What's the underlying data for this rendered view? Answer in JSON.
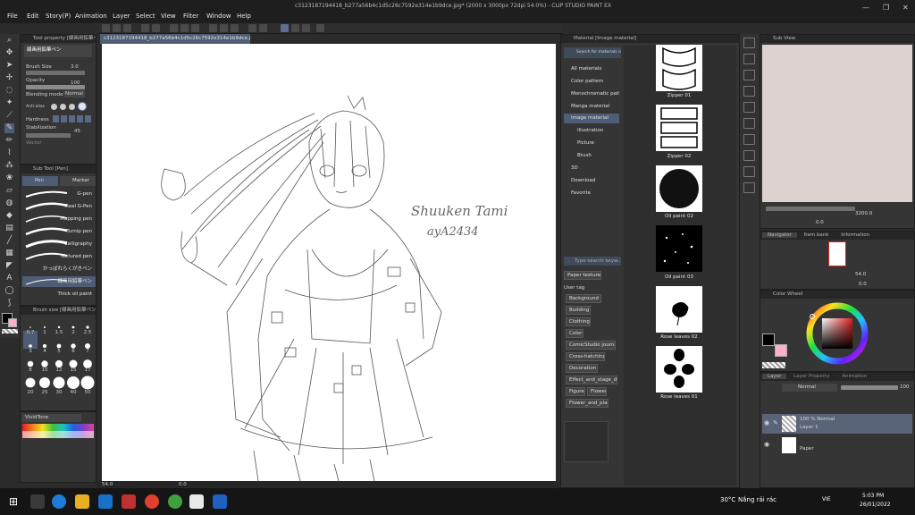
{
  "window": {
    "title": "c3123187194418_b277a56b4c1d5c26c7592e314e1b9dce.jpg* (2000 x 3000px 72dpi 54.0%) - CLIP STUDIO PAINT EX",
    "min_label": "—",
    "max_label": "❐",
    "close_label": "✕"
  },
  "menu": [
    "File",
    "Edit",
    "Story(P)",
    "Animation",
    "Layer",
    "Select",
    "View",
    "Filter",
    "Window",
    "Help"
  ],
  "document_tab": "c3123187194418_b277a56b4c1d5c26c7592e314e1b9dce.jpg*",
  "tool_property": {
    "header": "Tool property [線画用鉛筆ペン]",
    "brush_name": "線画用鉛筆ペン",
    "brush_size_label": "Brush Size",
    "brush_size_value": "3.0",
    "opacity_label": "Opacity",
    "opacity_value": "100",
    "blending_label": "Blending mode",
    "blending_value": "Normal",
    "antialiasing_label": "Anti-alias",
    "hardness_label": "Hardness",
    "stabilization_label": "Stabilization",
    "stabilization_value": "45",
    "vector_label": "Vector"
  },
  "sub_tool": {
    "header": "Sub Tool [Pen]",
    "tabs": [
      "Pen",
      "Marker"
    ],
    "brushes": [
      "G-pen",
      "Real G-Pen",
      "Mapping pen",
      "Turnip pen",
      "Calligraphy",
      "Textured pen",
      "かっぽれらくがきペン",
      "線画用鉛筆ペン",
      "Thick oil paint"
    ],
    "selected_index": 7
  },
  "brush_size_panel": {
    "header": "Brush size [線画用鉛筆ペン]",
    "sizes": [
      "0.7",
      "1",
      "1.5",
      "2",
      "2.5",
      "3",
      "4",
      "5",
      "6",
      "7",
      "8",
      "10",
      "12",
      "15",
      "17",
      "20",
      "25",
      "30",
      "40",
      "50"
    ],
    "selected": "3"
  },
  "color_set": {
    "name": "VividTone"
  },
  "material_panel": {
    "header": "Material [Image material]",
    "search_placeholder": "Search for materials on Assets",
    "tree": [
      "All materials",
      "Color pattern",
      "Monochromatic patt",
      "Manga material",
      "Image material",
      "Illustration",
      "Picture",
      "Brush",
      "3D",
      "Download",
      "Favorite"
    ],
    "selected_tree": "Image material",
    "tag_search_placeholder": "Type search keyw...",
    "paper_texture": "Paper texture",
    "user_tag_label": "User tag",
    "tags": [
      "Background",
      "Building",
      "Clothing",
      "Color",
      "ComicStudio journal",
      "Cross-hatching",
      "Decoration",
      "Effect_and_stage_dir",
      "Figure",
      "Flower",
      "Flower_and_plant"
    ],
    "items": [
      "Zipper 01",
      "Zipper 02",
      "Oil paint 02",
      "Oil paint 03",
      "Rose leaves 02",
      "Rose leaves 01"
    ]
  },
  "sub_view": {
    "header": "Sub View",
    "zoom": "3200.0",
    "rotate": "0.0"
  },
  "navigator": {
    "tabs": [
      "Navigator",
      "Item bank",
      "Information"
    ],
    "zoom": "54.0",
    "rotate": "0.0"
  },
  "color_wheel": {
    "header": "Color Wheel",
    "main_color": "#000000",
    "sub_color": "#ffb0c8"
  },
  "layer_panel": {
    "tabs": [
      "Layer",
      "Layer Property",
      "Animation"
    ],
    "blend_mode": "Normal",
    "opacity": "100",
    "layers": [
      {
        "meta": "100 % Normal",
        "name": "Layer 1"
      },
      {
        "meta": "",
        "name": "Paper"
      }
    ]
  },
  "canvas_status": {
    "zoom": "54.0",
    "angle": "0.0"
  },
  "sketch": {
    "signature_line1": "Shuuken Tami",
    "signature_line2": "ayA2434"
  },
  "taskbar": {
    "weather_temp": "30°C",
    "weather_text": "Nắng rải rác",
    "lang": "VIE",
    "time": "5:03 PM",
    "date": "26/01/2022"
  }
}
